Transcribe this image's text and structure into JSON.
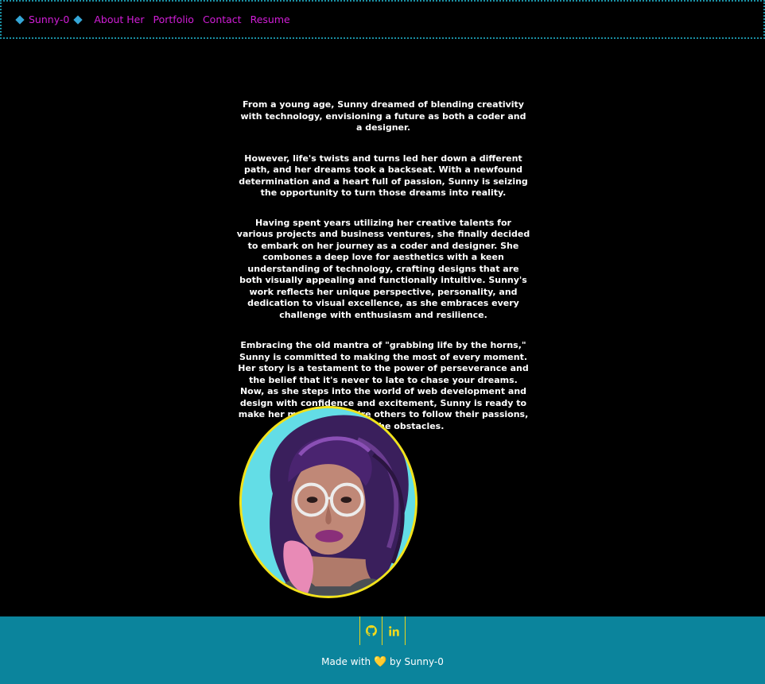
{
  "nav": {
    "brand": "Sunny-0",
    "links": [
      "About Her",
      "Portfolio",
      "Contact",
      "Resume"
    ]
  },
  "about": {
    "paragraphs": [
      "From a young age, Sunny dreamed of blending creativity with technology, envisioning a future as both a coder and a designer.",
      "However, life's twists and turns led her down a different path, and her dreams took a backseat. With a newfound determination and a heart full of passion, Sunny is seizing the opportunity to turn those dreams into reality.",
      "Having spent years utilizing her creative talents for various projects and business ventures, she finally decided to embark on her journey as a coder and designer. She combones a deep love for aesthetics with a keen understanding of technology, crafting designs that are both visually appealing and functionally intuitive. Sunny's work reflects her unique perspective, personality, and dedication to visual excellence, as she embraces every challenge with enthusiasm and resilience.",
      "Embracing the old mantra of \"grabbing life by the horns,\" Sunny is committed to making the most of every moment. Her story is a testament to the power of perseverance and the belief that it's never to late to chase your dreams. Now, as she steps into the world of web development and design with confidence and excitement, Sunny is ready to make her mark and inspire others to follow their passions, no matter the obstacles."
    ]
  },
  "footer": {
    "social": [
      "github-icon",
      "linkedin-icon"
    ],
    "credit_prefix": "Made with",
    "heart": "💛",
    "credit_suffix": "by Sunny-0"
  },
  "colors": {
    "nav_link": "#d21ed8",
    "nav_border": "#1a8fa3",
    "footer_bg": "#0b849c",
    "accent_yellow": "#f3e21a"
  }
}
